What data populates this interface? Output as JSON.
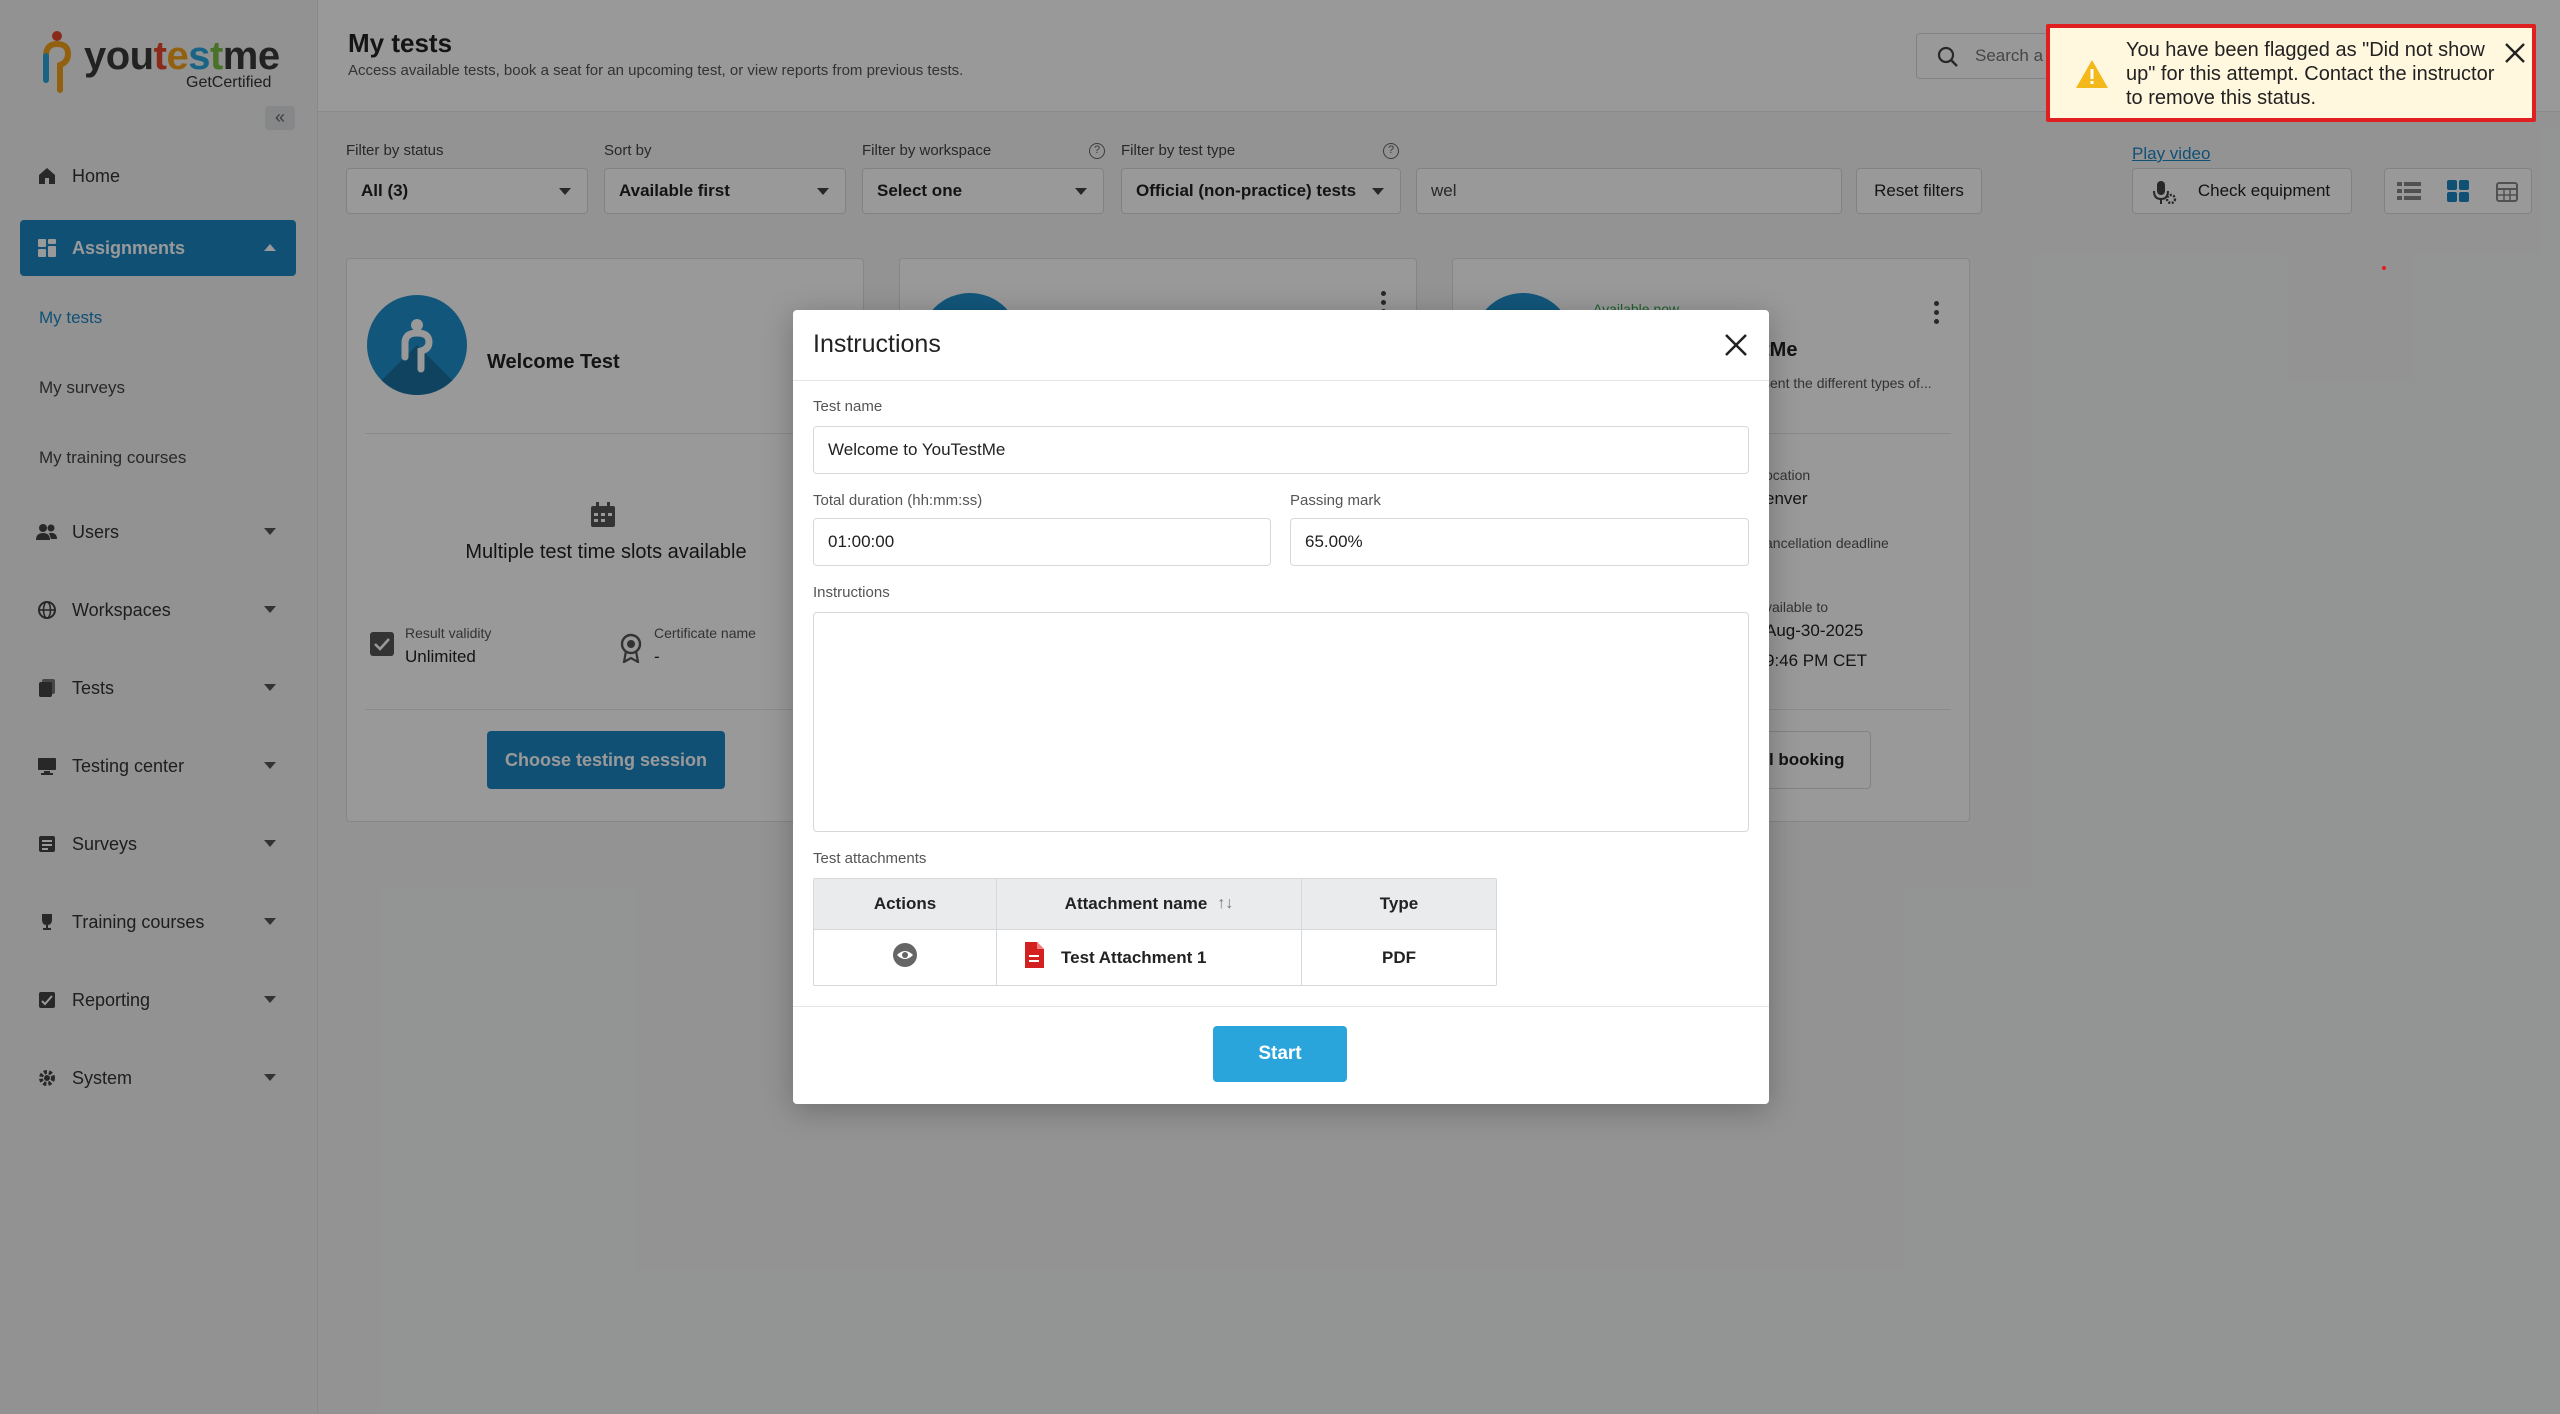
{
  "brand": {
    "logo_text_parts": [
      "you",
      "t",
      "e",
      "s",
      "t",
      "me"
    ],
    "sub": "GetCertified",
    "colors": {
      "primary": "#1d86c4",
      "accent": "#2aa5dc",
      "alert_border": "#e02020"
    }
  },
  "sidebar": {
    "collapse_icon": "double-chevron-left-icon",
    "items": [
      {
        "label": "Home",
        "icon": "home-icon"
      },
      {
        "label": "Assignments",
        "icon": "assignments-icon",
        "active": true
      },
      {
        "label": "Users",
        "icon": "users-icon"
      },
      {
        "label": "Workspaces",
        "icon": "globe-icon"
      },
      {
        "label": "Tests",
        "icon": "tests-icon"
      },
      {
        "label": "Testing center",
        "icon": "monitor-icon"
      },
      {
        "label": "Surveys",
        "icon": "surveys-icon"
      },
      {
        "label": "Training courses",
        "icon": "trophy-icon"
      },
      {
        "label": "Reporting",
        "icon": "reporting-icon"
      },
      {
        "label": "System",
        "icon": "gear-icon"
      }
    ],
    "sub_items": [
      {
        "label": "My tests",
        "selected": true
      },
      {
        "label": "My surveys"
      },
      {
        "label": "My training courses"
      }
    ]
  },
  "header": {
    "title": "My tests",
    "subtitle": "Access available tests, book a seat for an upcoming test, or view reports from previous tests.",
    "search_placeholder": "Search a"
  },
  "filters": {
    "status": {
      "label": "Filter by status",
      "value": "All (3)"
    },
    "sort": {
      "label": "Sort by",
      "value": "Available first"
    },
    "workspace": {
      "label": "Filter by workspace",
      "value": "Select one"
    },
    "test_type": {
      "label": "Filter by test type",
      "value": "Official (non-practice) tests"
    },
    "text_value": "wel",
    "reset_label": "Reset filters",
    "play_video": "Play video",
    "check_equipment": "Check equipment"
  },
  "cards": [
    {
      "title": "Welcome Test",
      "note": "Multiple test time slots available",
      "result_validity_label": "Result validity",
      "result_validity_value": "Unlimited",
      "certificate_label": "Certificate name",
      "certificate_value": "-",
      "action": "Choose testing session"
    },
    {
      "title_partial": "tMe",
      "desc_partial": "sent the different types of...",
      "location_label": "ocation",
      "location_value": "enver",
      "cancel_label": "ancellation deadline",
      "available_label": "vailable to",
      "available_date": "Aug-30-2025",
      "available_time": "9:46 PM CET",
      "action": "el booking",
      "status_partial": "Available now"
    }
  ],
  "modal": {
    "title": "Instructions",
    "test_name_label": "Test name",
    "test_name_value": "Welcome to YouTestMe",
    "duration_label": "Total duration (hh:mm:ss)",
    "duration_value": "01:00:00",
    "passing_label": "Passing mark",
    "passing_value": "65.00%",
    "instructions_label": "Instructions",
    "attachments_label": "Test attachments",
    "table": {
      "headers": [
        "Actions",
        "Attachment name",
        "Type"
      ],
      "rows": [
        {
          "name": "Test Attachment 1",
          "type": "PDF"
        }
      ]
    },
    "start_label": "Start"
  },
  "toast": {
    "message": "You have been flagged as \"Did not show up\" for this attempt. Contact the instructor to remove this status."
  }
}
